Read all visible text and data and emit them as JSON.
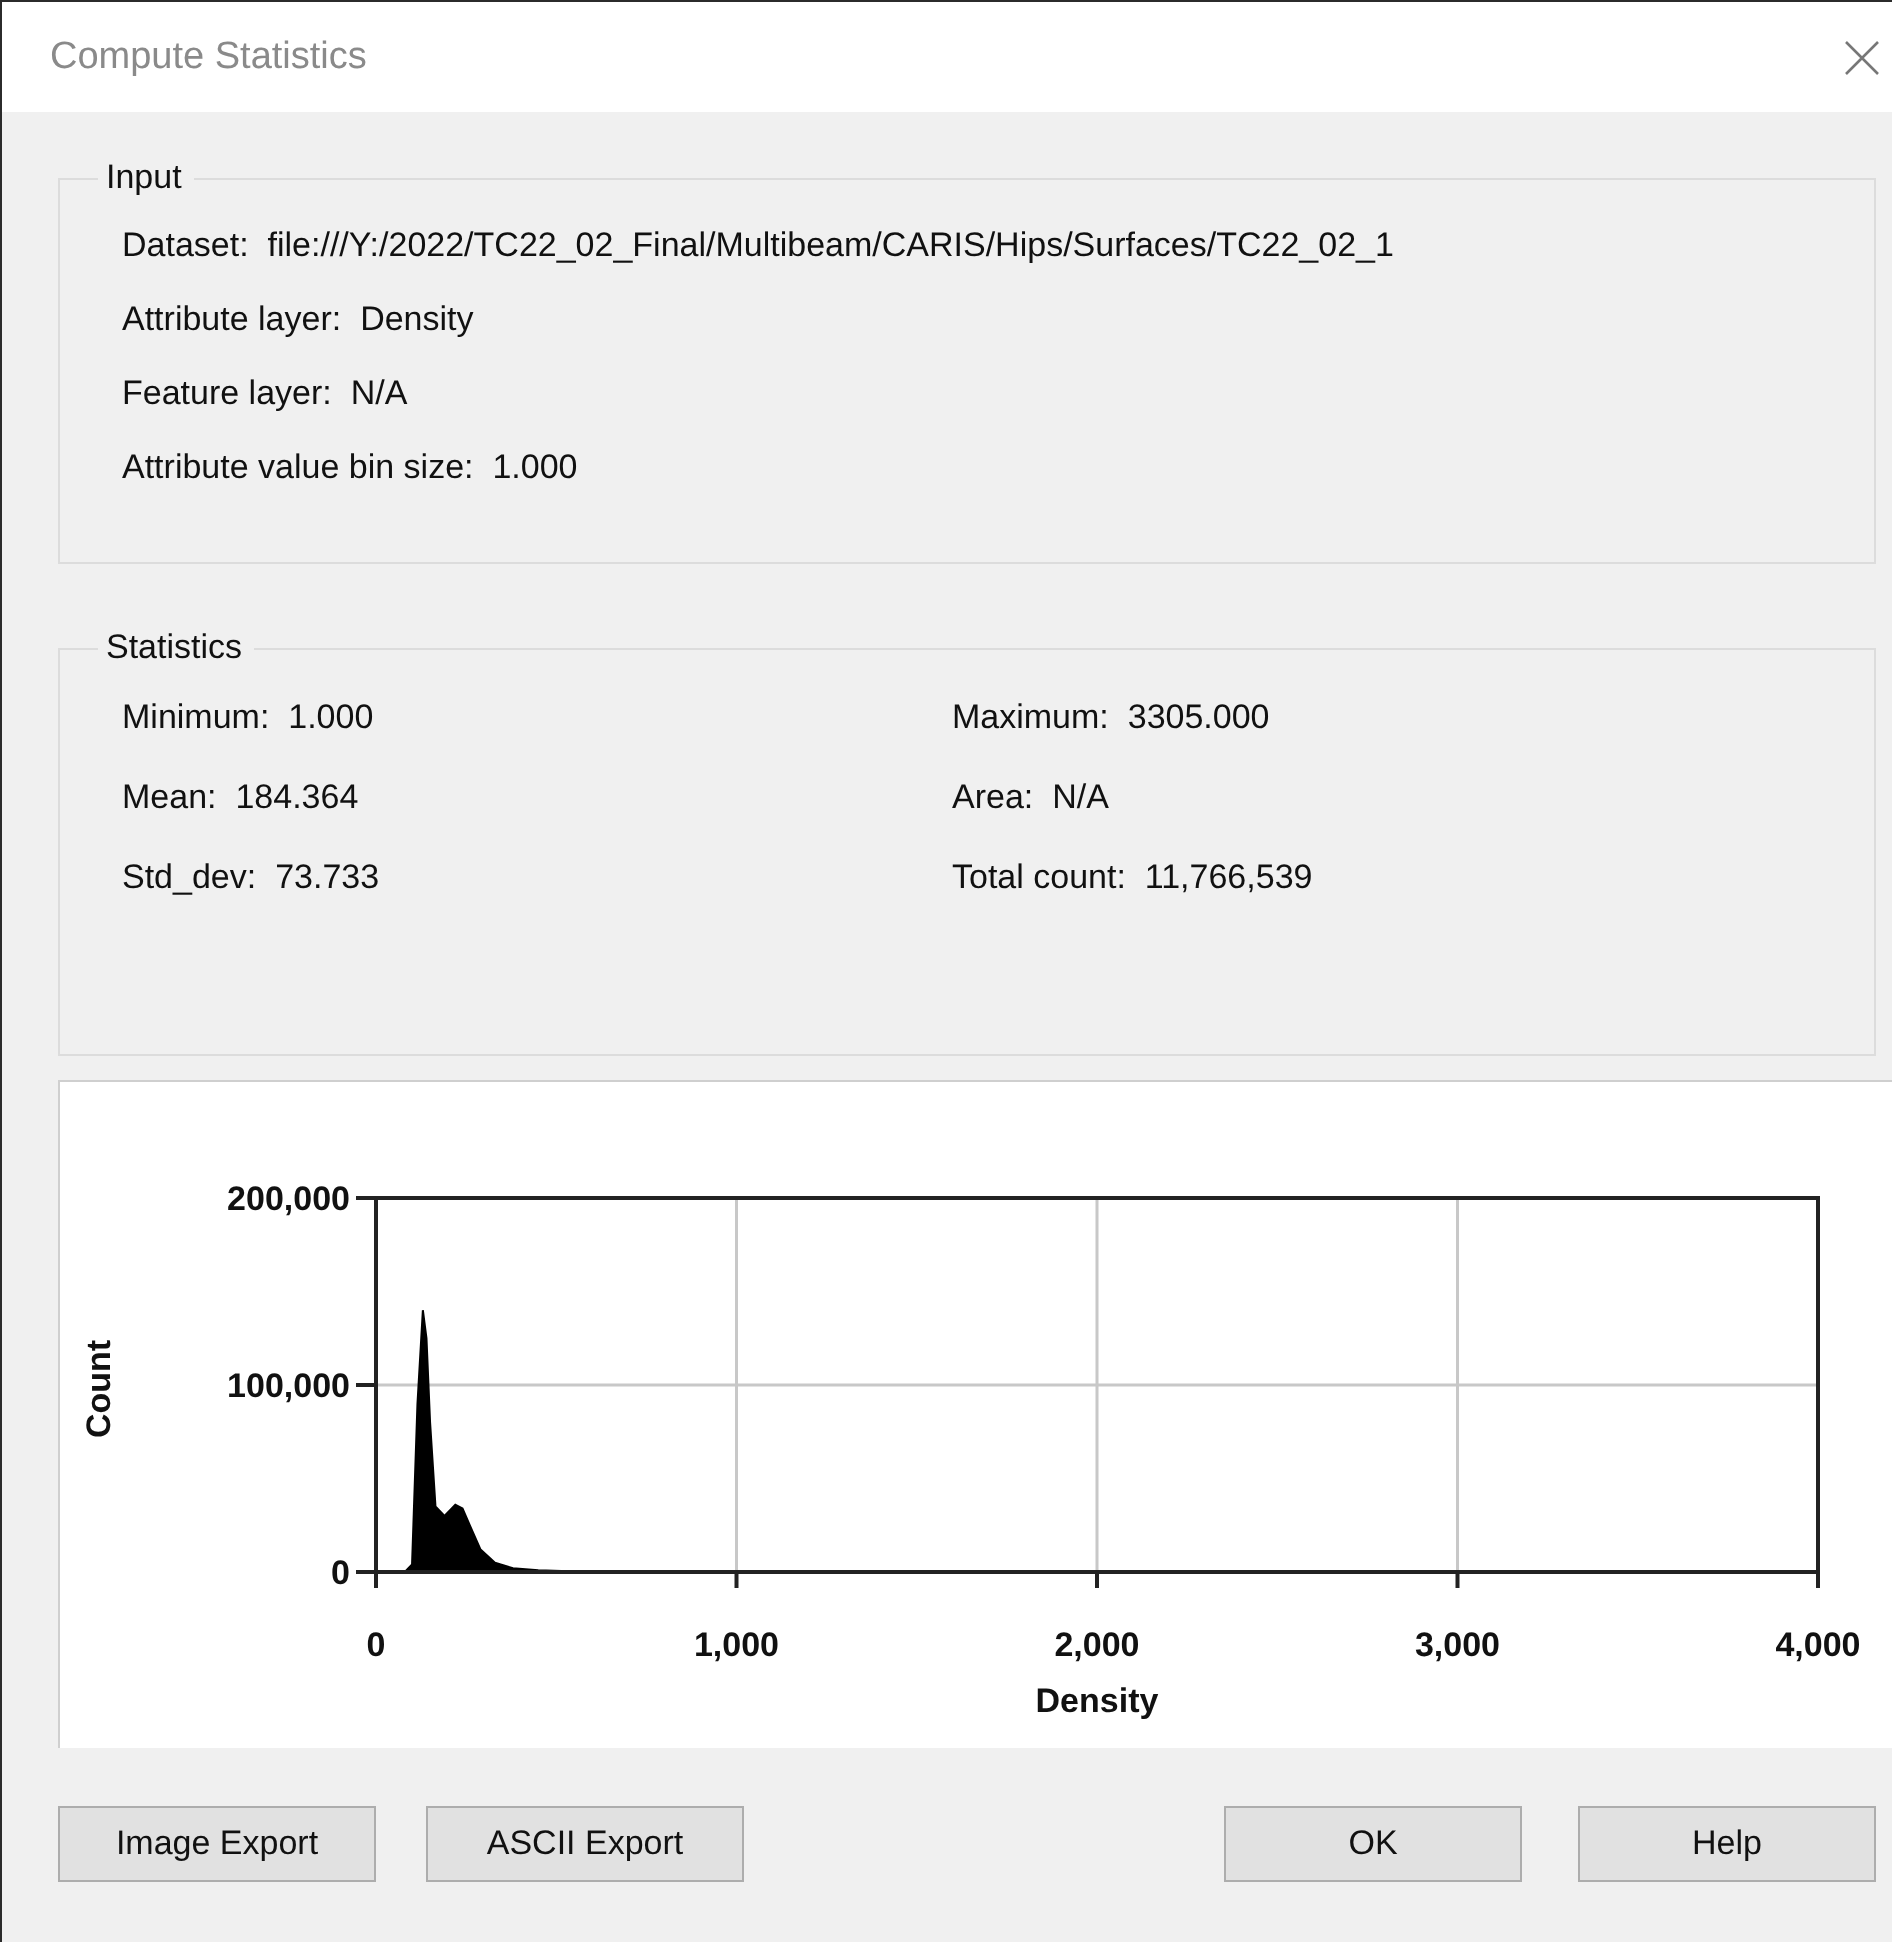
{
  "window": {
    "title": "Compute Statistics"
  },
  "input": {
    "legend": "Input",
    "fields": [
      {
        "label": "Dataset:",
        "value": "file:///Y:/2022/TC22_02_Final/Multibeam/CARIS/Hips/Surfaces/TC22_02_1"
      },
      {
        "label": "Attribute layer:",
        "value": "Density"
      },
      {
        "label": "Feature layer:",
        "value": "N/A"
      },
      {
        "label": "Attribute value bin size:",
        "value": "1.000"
      }
    ]
  },
  "statistics": {
    "legend": "Statistics",
    "fields": [
      {
        "label": "Minimum:",
        "value": "1.000"
      },
      {
        "label": "Maximum:",
        "value": "3305.000"
      },
      {
        "label": "Mean:",
        "value": "184.364"
      },
      {
        "label": "Area:",
        "value": "N/A"
      },
      {
        "label": "Std_dev:",
        "value": "73.733"
      },
      {
        "label": "Total count:",
        "value": "11,766,539"
      }
    ]
  },
  "histogram": {
    "chart_data": {
      "type": "area",
      "xlabel": "Density",
      "ylabel": "Count",
      "x": [
        0,
        80,
        100,
        115,
        130,
        140,
        150,
        165,
        190,
        220,
        240,
        260,
        290,
        330,
        380,
        450,
        600,
        1000,
        2000,
        3305,
        4000
      ],
      "series": [
        {
          "color": "#000000",
          "values": [
            0,
            0,
            4000,
            90000,
            140000,
            125000,
            80000,
            35000,
            30000,
            36000,
            34000,
            25000,
            12000,
            5000,
            2000,
            1000,
            0,
            0,
            0,
            0,
            0
          ]
        }
      ],
      "grid": true,
      "xlim": [
        0,
        4000
      ],
      "ylim": [
        0,
        200000
      ],
      "xticks": [
        {
          "value": 0,
          "label": "0"
        },
        {
          "value": 1000,
          "label": "1,000"
        },
        {
          "value": 2000,
          "label": "2,000"
        },
        {
          "value": 3000,
          "label": "3,000"
        },
        {
          "value": 4000,
          "label": "4,000"
        }
      ],
      "yticks": [
        {
          "value": 0,
          "label": "0"
        },
        {
          "value": 100000,
          "label": "100,000"
        },
        {
          "value": 200000,
          "label": "200,000"
        }
      ]
    }
  },
  "left_buttons": [
    {
      "label": "Image Export"
    },
    {
      "label": "ASCII Export"
    }
  ],
  "right_buttons": [
    {
      "label": "OK"
    },
    {
      "label": "Help"
    }
  ]
}
